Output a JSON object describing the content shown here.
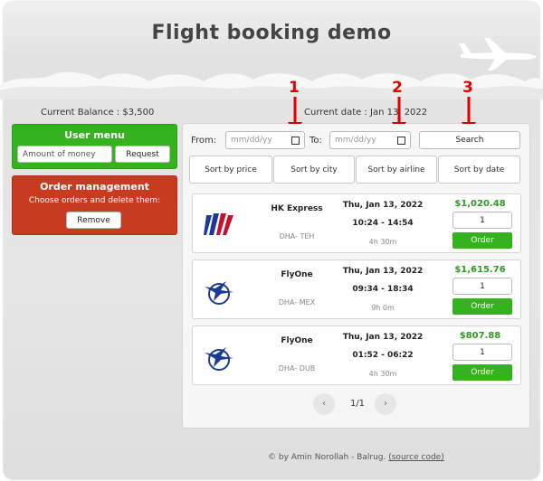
{
  "app": {
    "title": "Flight booking demo"
  },
  "header": {
    "balance": "Current Balance : $3,500",
    "current_date": "Current date : Jan 13, 2022"
  },
  "markers": [
    "1",
    "2",
    "3"
  ],
  "user_menu": {
    "title": "User menu",
    "amount_placeholder": "Amount of money",
    "request_label": "Request"
  },
  "order_management": {
    "title": "Order management",
    "description": "Choose orders and delete them:",
    "remove_label": "Remove"
  },
  "search": {
    "from_label": "From:",
    "to_label": "To:",
    "date_placeholder": "mm/dd/yy",
    "search_label": "Search"
  },
  "sort_buttons": [
    "Sort by price",
    "Sort by city",
    "Sort by airline",
    "Sort by date"
  ],
  "flights": [
    {
      "airline": "HK Express",
      "route": "DHA- TEH",
      "date": "Thu, Jan 13, 2022",
      "time": "10:24 - 14:54",
      "duration": "4h 30m",
      "price": "$1,020.48",
      "qty": "1",
      "order_label": "Order",
      "logo": "united-tulip-logo"
    },
    {
      "airline": "FlyOne",
      "route": "DHA- MEX",
      "date": "Thu, Jan 13, 2022",
      "time": "09:34 - 18:34",
      "duration": "9h 0m",
      "price": "$1,615.76",
      "qty": "1",
      "order_label": "Order",
      "logo": "bird-globe-logo"
    },
    {
      "airline": "FlyOne",
      "route": "DHA- DUB",
      "date": "Thu, Jan 13, 2022",
      "time": "01:52 - 06:22",
      "duration": "4h 30m",
      "price": "$807.88",
      "qty": "1",
      "order_label": "Order",
      "logo": "bird-globe-logo"
    }
  ],
  "pagination": {
    "prev": "‹",
    "page": "1/1",
    "next": "›"
  },
  "footer": {
    "credit": "© by Amin Norollah - Balrug.",
    "source_link": "(source code)"
  },
  "colors": {
    "accent_green": "#35b31f",
    "accent_red": "#c73c20",
    "price_green": "#2e9b23",
    "marker_red": "#e10000"
  }
}
